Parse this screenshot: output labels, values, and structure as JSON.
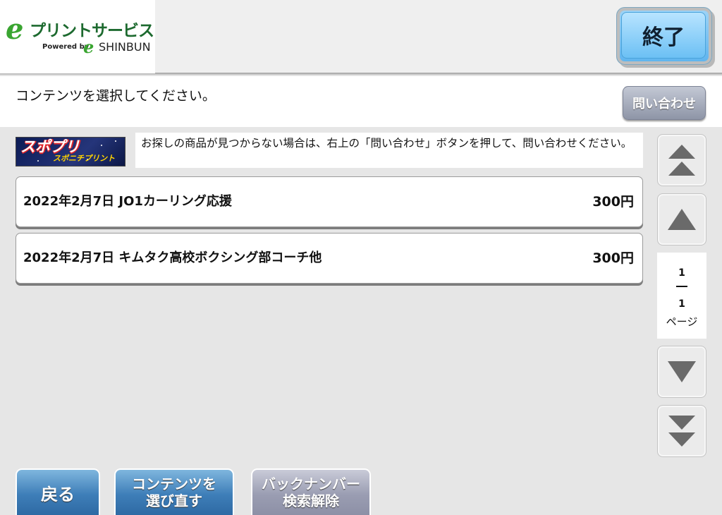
{
  "header": {
    "logo": {
      "title": "プリントサービス",
      "powered_by": "Powered by",
      "brand": "SHINBUN"
    },
    "end_label": "終了"
  },
  "instruction": {
    "text": "コンテンツを選択してください。",
    "inquiry_label": "問い合わせ"
  },
  "banner": {
    "main": "スポプリ",
    "sub": "スポニチプリント"
  },
  "notice": "お探しの商品が見つからない場合は、右上の「問い合わせ」ボタンを押して、問い合わせください。",
  "items": [
    {
      "title": "2022年2月7日 JO1カーリング応援",
      "price": "300円"
    },
    {
      "title": "2022年2月7日 キムタク高校ボクシング部コーチ他",
      "price": "300円"
    }
  ],
  "pager": {
    "current": "1",
    "total": "1",
    "label": "ページ"
  },
  "bottom": {
    "back_label": "戻る",
    "reselect_label": "コンテンツを\n選び直す",
    "backnumber_label": "バックナンバー\n検索解除"
  },
  "colors": {
    "accent_blue": "#5db3ee",
    "button_blue": "#3e7eb8",
    "button_gray": "#9a9db2",
    "logo_green": "#3aa531"
  }
}
